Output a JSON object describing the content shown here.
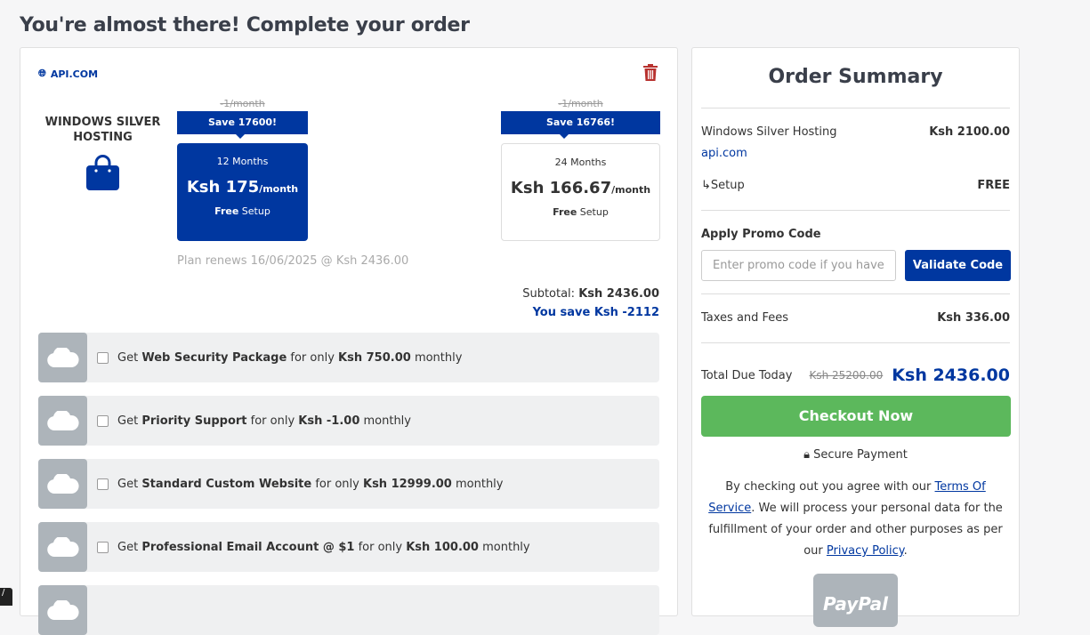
{
  "page": {
    "title": "You're almost there! Complete your order"
  },
  "product": {
    "domain": "API.COM",
    "name": "WINDOWS SILVER HOSTING",
    "options": [
      {
        "old": "-1/month",
        "save": "Save 17600!",
        "term": "12 Months",
        "price": "Ksh 175",
        "unit": "/month",
        "setup_bold": "Free",
        "setup": " Setup",
        "selected": true
      },
      {
        "old": "-1/month",
        "save": "Save 16766!",
        "term": "24 Months",
        "price": "Ksh 166.67",
        "unit": "/month",
        "setup_bold": "Free",
        "setup": " Setup",
        "selected": false
      }
    ],
    "renew": "Plan renews 16/06/2025 @ Ksh 2436.00",
    "subtotal_label": "Subtotal: ",
    "subtotal": "Ksh 2436.00",
    "save_label": "You save Ksh -2112"
  },
  "addons": [
    {
      "pre": "Get ",
      "name": "Web Security Package",
      "mid": " for only ",
      "price": "Ksh 750.00",
      "post": " monthly"
    },
    {
      "pre": "Get ",
      "name": "Priority Support",
      "mid": " for only ",
      "price": "Ksh -1.00",
      "post": " monthly"
    },
    {
      "pre": "Get ",
      "name": "Standard Custom Website",
      "mid": " for only ",
      "price": "Ksh 12999.00",
      "post": " monthly"
    },
    {
      "pre": "Get ",
      "name": "Professional Email Account @ $1",
      "mid": " for only ",
      "price": "Ksh 100.00",
      "post": " monthly"
    }
  ],
  "summary": {
    "title": "Order Summary",
    "item": "Windows Silver Hosting",
    "item_price": "Ksh 2100.00",
    "item_domain": "api.com",
    "setup": "↳Setup",
    "setup_price": "FREE",
    "promo_label": "Apply Promo Code",
    "promo_placeholder": "Enter promo code if you have",
    "validate": "Validate Code",
    "taxes": "Taxes and Fees",
    "taxes_price": "Ksh 336.00",
    "total_label": "Total Due Today",
    "total_old": "Ksh 25200.00",
    "total": "Ksh 2436.00",
    "checkout": "Checkout Now",
    "secure": "Secure Payment",
    "terms_1": "By checking out you agree with our ",
    "terms_link": "Terms Of Service",
    "terms_2": ". We will process your personal data for the fulfillment of your order and other purposes as per our ",
    "privacy_link": "Privacy Policy",
    "terms_3": ".",
    "paypal": "PayPal"
  },
  "tooltip": "/"
}
